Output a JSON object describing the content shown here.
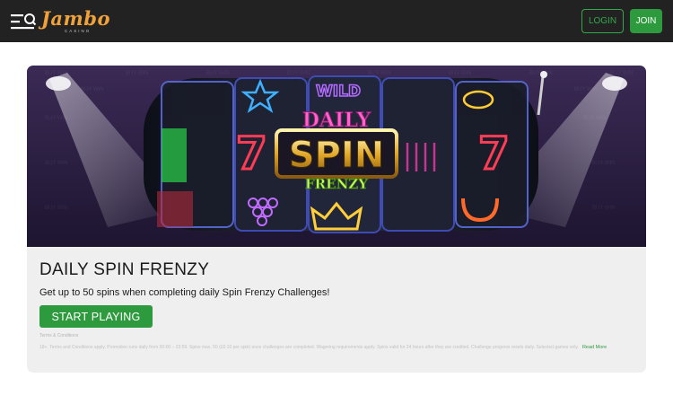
{
  "header": {
    "logo_text": "Jambo",
    "logo_subtext": "CASINO",
    "login_label": "LOGIN",
    "join_label": "JOIN",
    "menu_icon": "menu-search-icon"
  },
  "colors": {
    "header_bg": "#222222",
    "accent_green": "#2e9a3e",
    "logo_orange": "#f0a23a",
    "card_bg": "#efefef"
  },
  "promo": {
    "banner": {
      "watermark_text": "BUY WIN",
      "wild_label": "WILD",
      "logo_line1": "DAILY",
      "logo_line2": "SPIN",
      "logo_line3": "FRENZY",
      "seven_label": "7"
    },
    "title": "DAILY SPIN FRENZY",
    "description": "Get up to 50 spins when completing daily Spin Frenzy Challenges!",
    "cta_label": "START PLAYING",
    "terms_title": "Terms & Conditions",
    "terms_text": "18+. Terms and Conditions apply. Promotion runs daily from 00:00 – 23:59. Spins max. 50 (£0.10 per spin) once challenges are completed. Wagering requirements apply. Spins valid for 24 hours after they are credited. Challenge progress resets daily. Selected games only.",
    "read_more_label": "Read More"
  }
}
